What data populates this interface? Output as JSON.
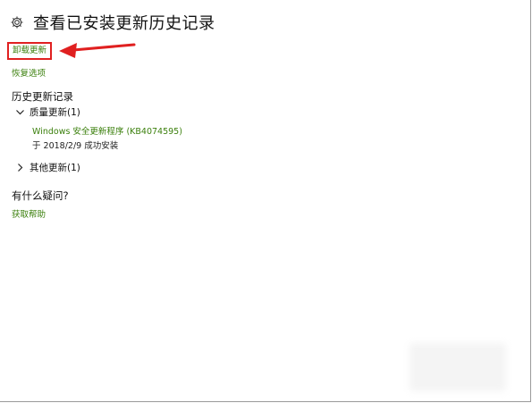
{
  "header": {
    "title": "查看已安装更新历史记录",
    "icon": "gear-icon"
  },
  "links": {
    "uninstall_label": "卸载更新",
    "recovery_label": "恢复选项",
    "help_label": "获取帮助"
  },
  "history": {
    "title": "历史更新记录",
    "groups": [
      {
        "label": "质量更新(1)",
        "expanded": true,
        "items": [
          {
            "name": "Windows 安全更新程序 (KB4074595)",
            "status": "于 2018/2/9 成功安装"
          }
        ]
      },
      {
        "label": "其他更新(1)",
        "expanded": false
      }
    ]
  },
  "faq": {
    "title": "有什么疑问?"
  },
  "colors": {
    "link": "#3a7f0b",
    "highlight_box": "#e02020",
    "arrow": "#e02020",
    "text": "#111111"
  }
}
